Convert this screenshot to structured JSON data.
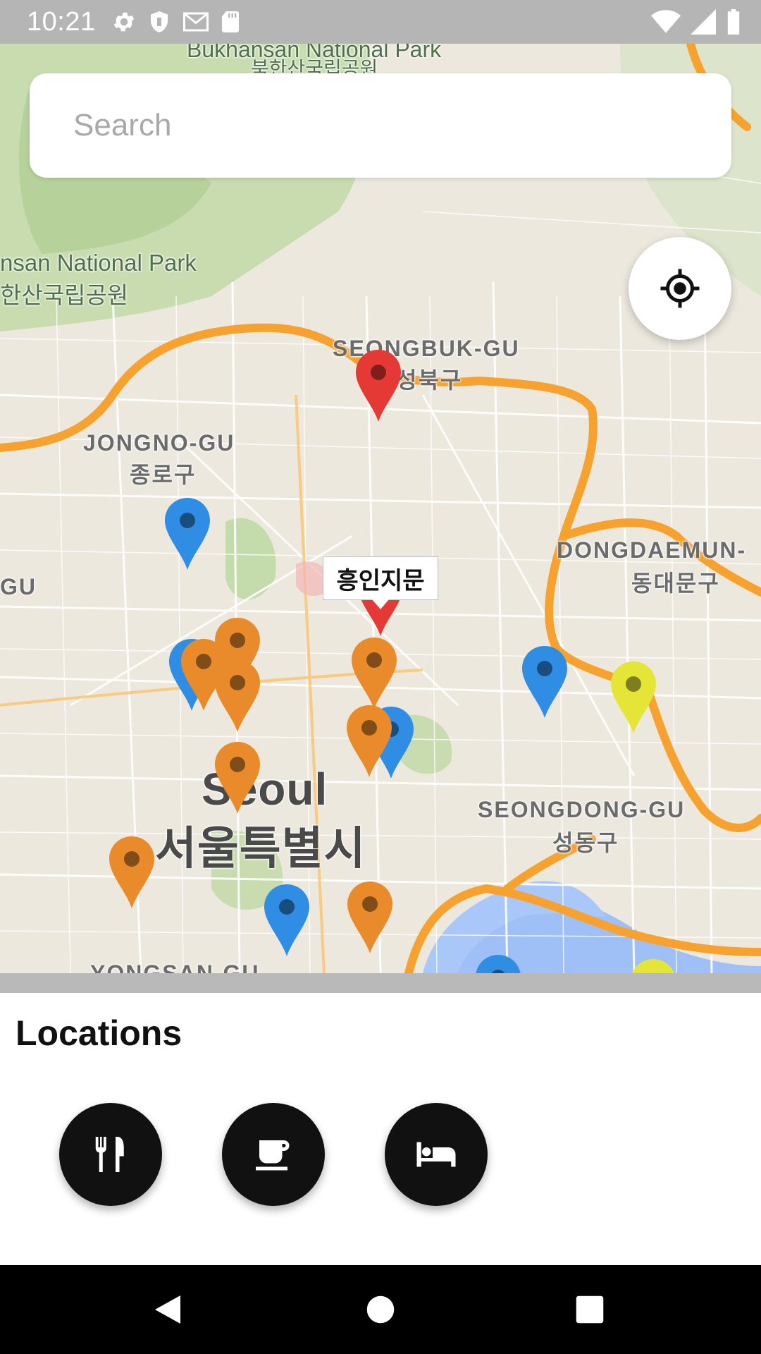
{
  "status_bar": {
    "time": "10:21",
    "left_icons": [
      "settings-icon",
      "shield-icon",
      "gmail-icon",
      "sd-card-icon"
    ],
    "right_icons": [
      "wifi-icon",
      "signal-icon",
      "battery-icon"
    ]
  },
  "search": {
    "placeholder": "Search",
    "value": ""
  },
  "map": {
    "labels": {
      "bukhansan_top_en": "Bukhansan National Park",
      "bukhansan_top_ko": "북한산국립공원",
      "bukhansan_en": "nsan National Park",
      "bukhansan_ko": "한산국립공원",
      "seongbuk_en": "SEONGBUK-GU",
      "seongbuk_ko": "성북구",
      "jongno_en": "JONGNO-GU",
      "jongno_ko": "종로구",
      "dongdaemun_en": "DONGDAEMUN-",
      "dongdaemun_ko": "동대문구",
      "gu_left": "GU",
      "seoul_en": "Seoul",
      "seoul_ko": "서울특별시",
      "seongdong_en": "SEONGDONG-GU",
      "seongdong_ko": "성동구",
      "yongsan_en": "YONGSAN-GU"
    },
    "info_window": "흥인지문",
    "marker_colors": {
      "red": "#e53935",
      "orange": "#e98b2a",
      "blue": "#2f8de4",
      "yellow": "#e5e538"
    }
  },
  "panel": {
    "title": "Locations",
    "categories": [
      "restaurant-icon",
      "cafe-icon",
      "hotel-icon"
    ]
  },
  "nav": [
    "back-icon",
    "home-icon",
    "recents-icon"
  ]
}
